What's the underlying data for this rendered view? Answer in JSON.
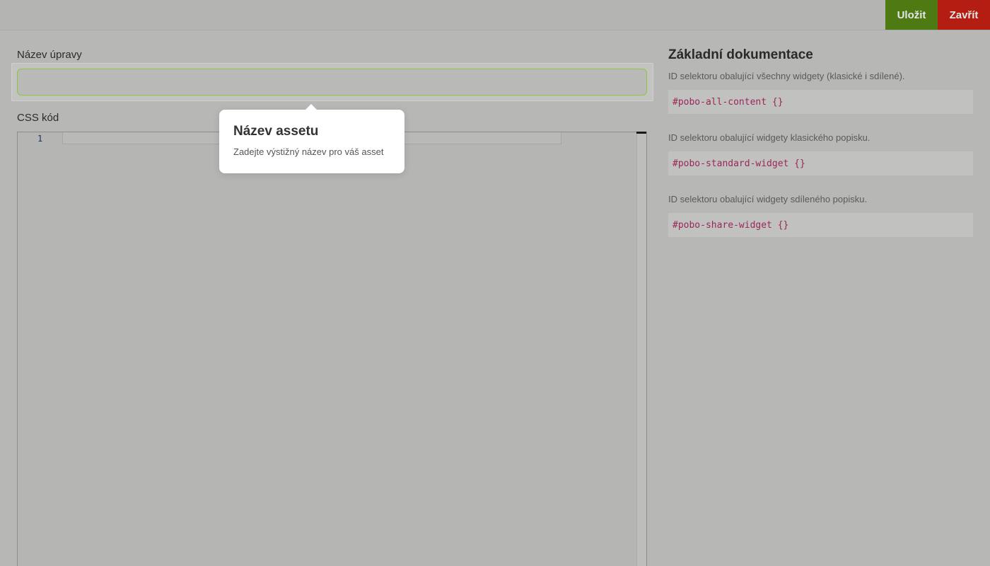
{
  "toolbar": {
    "save_label": "Uložit",
    "close_label": "Zavřít",
    "save_color": "#4e7a14",
    "close_color": "#b31d12"
  },
  "form": {
    "name_label": "Název úpravy",
    "name_value": "",
    "css_label": "CSS kód",
    "editor_line_numbers": [
      "1"
    ]
  },
  "tooltip": {
    "title": "Název assetu",
    "text": "Zadejte výstižný název pro váš asset"
  },
  "docs": {
    "title": "Základní dokumentace",
    "items": [
      {
        "description": "ID selektoru obalující všechny widgety (klasické i sdílené).",
        "code": "#pobo-all-content {}"
      },
      {
        "description": "ID selektoru obalující widgety klasického popisku.",
        "code": "#pobo-standard-widget {}"
      },
      {
        "description": "ID selektoru obalující widgety sdíleného popisku.",
        "code": "#pobo-share-widget {}"
      }
    ]
  }
}
